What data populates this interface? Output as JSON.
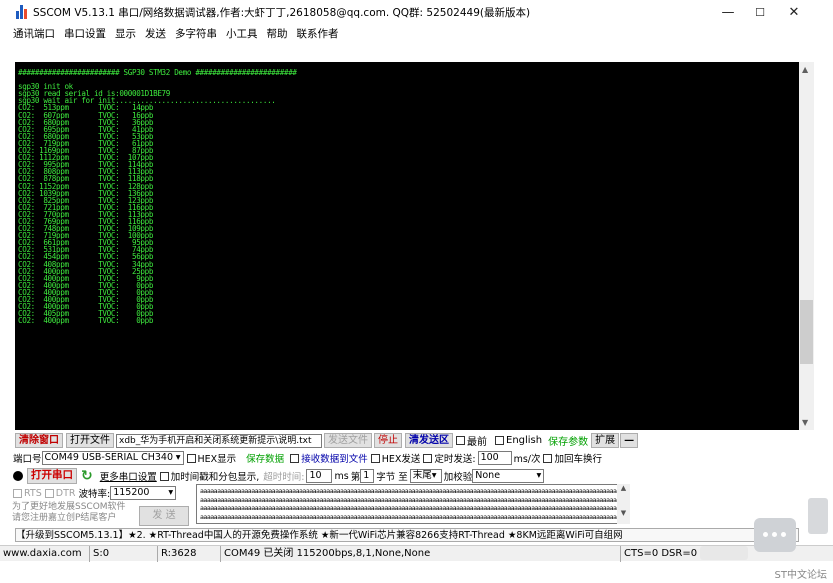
{
  "window": {
    "title": "SSCOM V5.13.1 串口/网络数据调试器,作者:大虾丁丁,2618058@qq.com. QQ群: 52502449(最新版本)",
    "minimize": "—",
    "maximize": "☐",
    "close": "✕"
  },
  "menu": [
    "通讯端口",
    "串口设置",
    "显示",
    "发送",
    "多字符串",
    "小工具",
    "帮助",
    "联系作者"
  ],
  "console_lines": [
    "######################## SGP30 STM32 Demo ########################",
    "",
    "sgp30 init ok",
    "sgp30 read serial id is:000001D1BE79",
    "sgp30 wait air for init......................................",
    "CO2:  513ppm       TVOC:   14ppb",
    "CO2:  607ppm       TVOC:   16ppb",
    "CO2:  680ppm       TVOC:   36ppb",
    "CO2:  695ppm       TVOC:   41ppb",
    "CO2:  680ppm       TVOC:   53ppb",
    "CO2:  719ppm       TVOC:   61ppb",
    "CO2: 1169ppm       TVOC:   87ppb",
    "CO2: 1112ppm       TVOC:  107ppb",
    "CO2:  995ppm       TVOC:  114ppb",
    "CO2:  808ppm       TVOC:  113ppb",
    "CO2:  878ppm       TVOC:  118ppb",
    "CO2: 1152ppm       TVOC:  128ppb",
    "CO2: 1039ppm       TVOC:  136ppb",
    "CO2:  825ppm       TVOC:  123ppb",
    "CO2:  721ppm       TVOC:  116ppb",
    "CO2:  770ppm       TVOC:  113ppb",
    "CO2:  769ppm       TVOC:  116ppb",
    "CO2:  748ppm       TVOC:  109ppb",
    "CO2:  719ppm       TVOC:  100ppb",
    "CO2:  661ppm       TVOC:   95ppb",
    "CO2:  531ppm       TVOC:   74ppb",
    "CO2:  454ppm       TVOC:   56ppb",
    "CO2:  408ppm       TVOC:   34ppb",
    "CO2:  400ppm       TVOC:   25ppb",
    "CO2:  400ppm       TVOC:    9ppb",
    "CO2:  400ppm       TVOC:    0ppb",
    "CO2:  400ppm       TVOC:    0ppb",
    "CO2:  400ppm       TVOC:    0ppb",
    "CO2:  400ppm       TVOC:    0ppb",
    "CO2:  405ppm       TVOC:    0ppb",
    "CO2:  400ppm       TVOC:    0ppb"
  ],
  "toolbar1": {
    "clear_window": "清除窗口",
    "open_file": "打开文件",
    "file_path": "xdb_华为手机开启和关闭系统更新提示\\说明.txt",
    "send_file": "发送文件",
    "stop": "停止",
    "clear_send": "清发送区",
    "topmost": "最前",
    "english": "English",
    "save_params": "保存参数",
    "expand": "扩展",
    "dash": "—"
  },
  "toolbar2": {
    "port_label": "端口号",
    "port_value": "COM49 USB-SERIAL CH340",
    "hex_display": "HEX显示",
    "save_data": "保存数据",
    "recv_to_file": "接收数据到文件",
    "hex_send": "HEX发送",
    "timed_send": "定时发送:",
    "interval": "100",
    "interval_unit": "ms/次",
    "add_crlf": "加回车换行"
  },
  "toolbar3": {
    "open_port": "打开串口",
    "more_settings": "更多串口设置",
    "add_timestamp": "加时间戳和分包显示,",
    "timeout_label": "超时时间:",
    "timeout_value": "10",
    "timeout_unit": "ms",
    "byte_prefix": "第",
    "byte_index": "1",
    "byte_label": "字节 至",
    "end_select": "末尾",
    "checksum_label": "加校验",
    "checksum_value": "None"
  },
  "toolbar4": {
    "rts": "RTS",
    "dtr": "DTR",
    "baud_label": "波特率:",
    "baud_value": "115200"
  },
  "send_area": {
    "note": "为了更好地发展SSCOM软件\n请您注册嘉立创P结尾客户",
    "send_button": "发 送",
    "content": "aaaaaaaaaaaaaaaaaaaaaaaaaaaaaaaaaaaaaaaaaaaaaaaaaaaaaaaaaaaaaaaaaaaaaaaaaaaaaaaaaaaaaaaaaaaaaaaaaaaaaaaaaaaaaaaaaaaaaaaaaaaaaaa\naaaaaaaaaaaaaaaaaaaaaaaaaaaaaaaaaaaaaaaaaaaaaaaaaaaaaaaaaaaaaaaaaaaaaaaaaaaaaaaaaaaaaaaaaaaaaaaaaaaaaaaaaaaaaaaaaaaaaaaaaaaaaaa\naaaaaaaaaaaaaaaaaaaaaaaaaaaaaaaaaaaaaaaaaaaaaaaaaaaaaaaaaaaaaaaaaaaaaaaaaaaaaaaaaaaaaaaaaaaaaaaaaaaaaaaaaaaaaaaaaaaaaaaaaaaaaaa\naaaaaaaaaaaaaaaaaaaaaaaaaaaaaaaaaaaaaaaaaaaaaaaaaaaaaaaaaaaaaaaaaaaaaaaaaaaaaaaaaaaaaaaaaaaaaaaaaaaaaaaaaaaaaaaaaaaaaaaaaaaaaaa"
  },
  "promo": "【升级到SSCOM5.13.1】★2. ★RT-Thread中国人的开源免费操作系统 ★新一代WiFi芯片兼容8266支持RT-Thread ★8KM远距离WiFi可自组网",
  "status": {
    "site": "www.daxia.com",
    "s": "S:0",
    "r": "R:3628",
    "port_state": "COM49 已关闭  115200bps,8,1,None,None",
    "lines": "CTS=0 DSR=0"
  },
  "watermark": "ST中文论坛"
}
